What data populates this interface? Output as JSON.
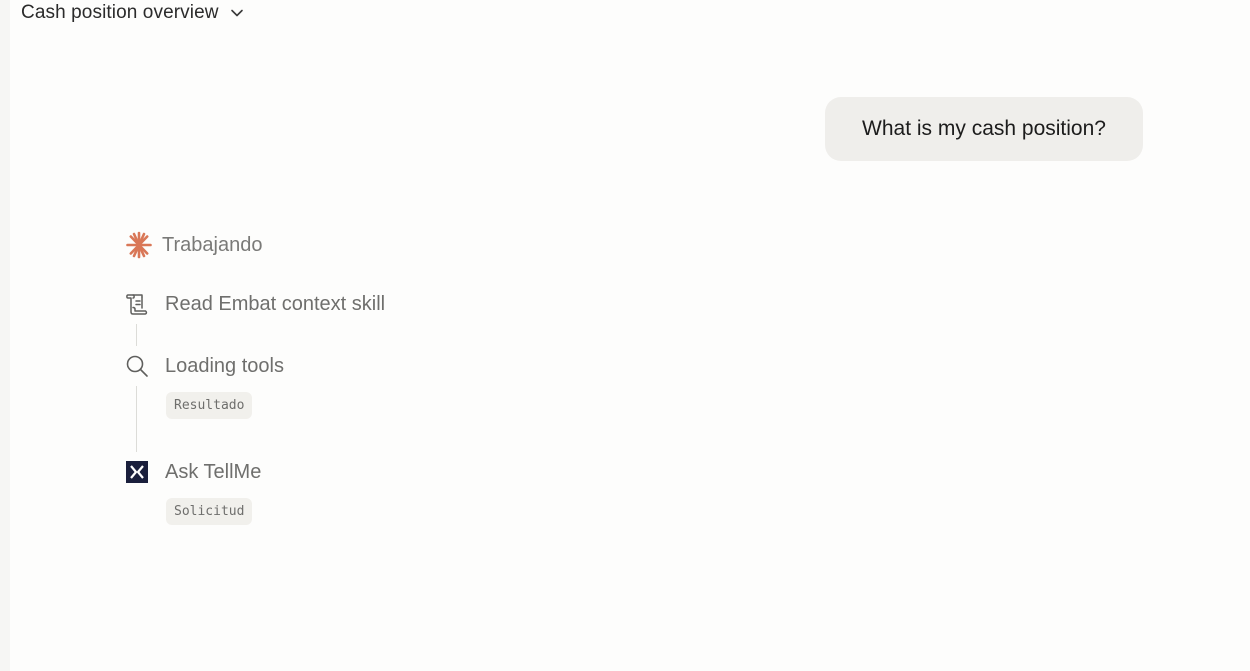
{
  "header": {
    "title": "Cash position overview",
    "dropdown_icon": "chevron-down-icon"
  },
  "conversation": {
    "user_message": "What is my cash position?"
  },
  "assistant": {
    "status": {
      "label": "Trabajando",
      "icon": "sparkle-icon",
      "color": "#d97757"
    },
    "steps": [
      {
        "label": "Read Embat context skill",
        "icon": "scroll-icon",
        "chip": ""
      },
      {
        "label": "Loading tools",
        "icon": "search-icon",
        "chip": "Resultado"
      },
      {
        "label": "Ask TellMe",
        "icon": "tellme-logo-icon",
        "chip": "Solicitud"
      }
    ]
  }
}
